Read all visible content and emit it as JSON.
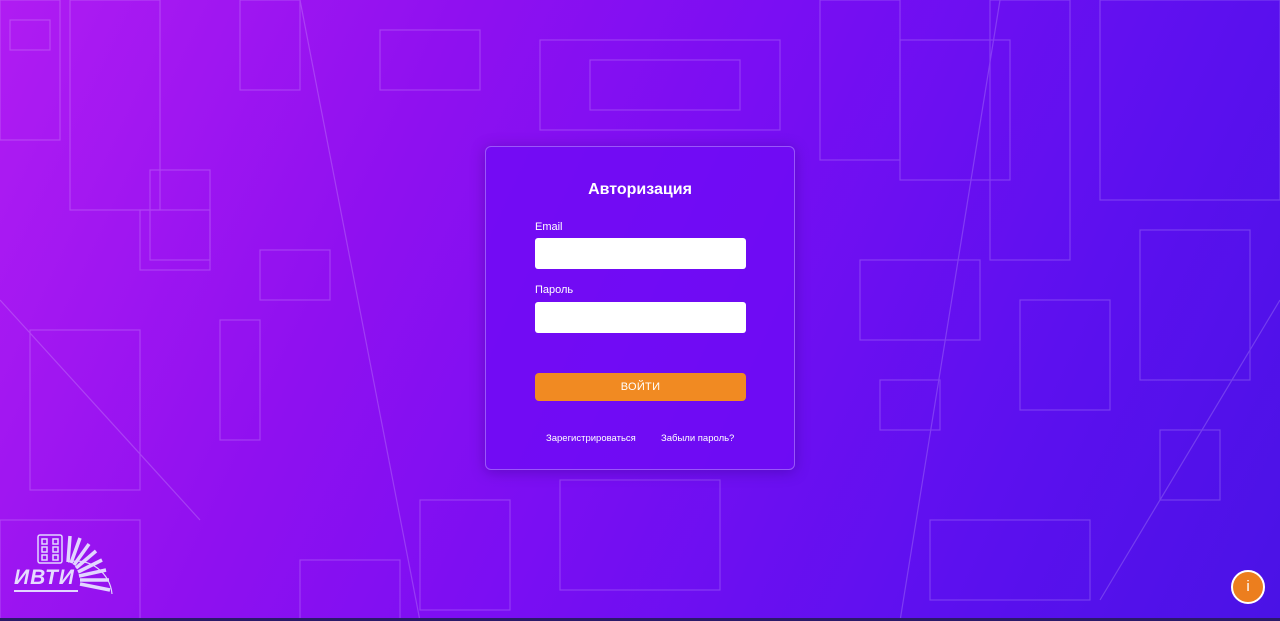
{
  "login_form": {
    "title": "Авторизация",
    "email_label": "Email",
    "email_value": "",
    "password_label": "Пароль",
    "password_value": "",
    "submit_label": "Войти",
    "register_link": "Зарегистрироваться",
    "forgot_link": "Забыли пароль?"
  },
  "logo": {
    "text": "ИВТИ",
    "icon": "ivti-logo"
  },
  "info_button": {
    "label": "i",
    "icon": "info-icon"
  },
  "colors": {
    "background_gradient_start": "#b01cf2",
    "background_gradient_end": "#4a12e6",
    "card_background": "#6e0af5",
    "accent_orange": "#f18a22",
    "text": "#ffffff"
  }
}
